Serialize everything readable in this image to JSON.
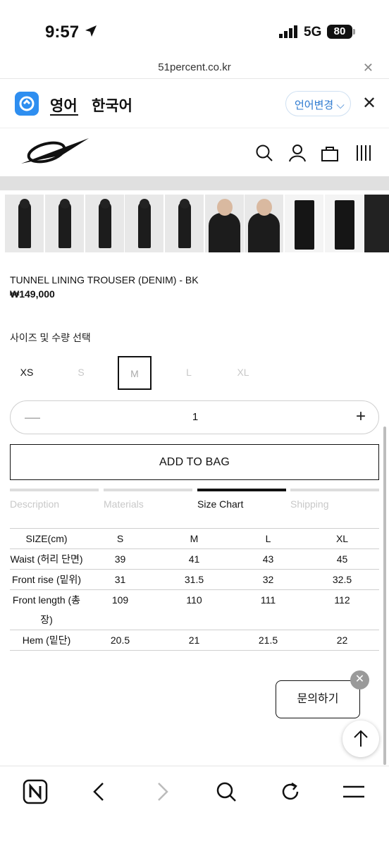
{
  "status": {
    "time": "9:57",
    "network": "5G",
    "battery": "80"
  },
  "browser": {
    "url": "51percent.co.kr"
  },
  "translate": {
    "source_lang": "영어",
    "target_lang": "한국어",
    "change_label": "언어변경 ⌵"
  },
  "product": {
    "title": "TUNNEL LINING TROUSER (DENIM) - BK",
    "price": "₩149,000",
    "size_select_label": "사이즈 및 수량 선택",
    "sizes": [
      {
        "label": "XS",
        "state": "available"
      },
      {
        "label": "S",
        "state": "disabled"
      },
      {
        "label": "M",
        "state": "selected"
      },
      {
        "label": "L",
        "state": "disabled"
      },
      {
        "label": "XL",
        "state": "disabled"
      }
    ],
    "quantity": "1",
    "add_to_bag": "ADD TO BAG"
  },
  "tabs": [
    {
      "label": "Description",
      "active": false
    },
    {
      "label": "Materials",
      "active": false
    },
    {
      "label": "Size Chart",
      "active": true
    },
    {
      "label": "Shipping",
      "active": false
    }
  ],
  "size_chart": {
    "headers": [
      "SIZE(cm)",
      "S",
      "M",
      "L",
      "XL"
    ],
    "rows": [
      {
        "name": "Waist (허리 단면)",
        "values": [
          "39",
          "41",
          "43",
          "45"
        ]
      },
      {
        "name": "Front rise (밑위)",
        "values": [
          "31",
          "31.5",
          "32",
          "32.5"
        ]
      },
      {
        "name_line1": "Front length (총",
        "name_line2": "장)",
        "values": [
          "109",
          "110",
          "111",
          "112"
        ]
      },
      {
        "name": "Hem (밑단)",
        "values": [
          "20.5",
          "21",
          "21.5",
          "22"
        ]
      }
    ]
  },
  "inquiry": {
    "label": "문의하기"
  },
  "colors": {
    "accent_blue": "#2e8ef0",
    "text": "#111111",
    "muted": "#c8c8c8"
  }
}
